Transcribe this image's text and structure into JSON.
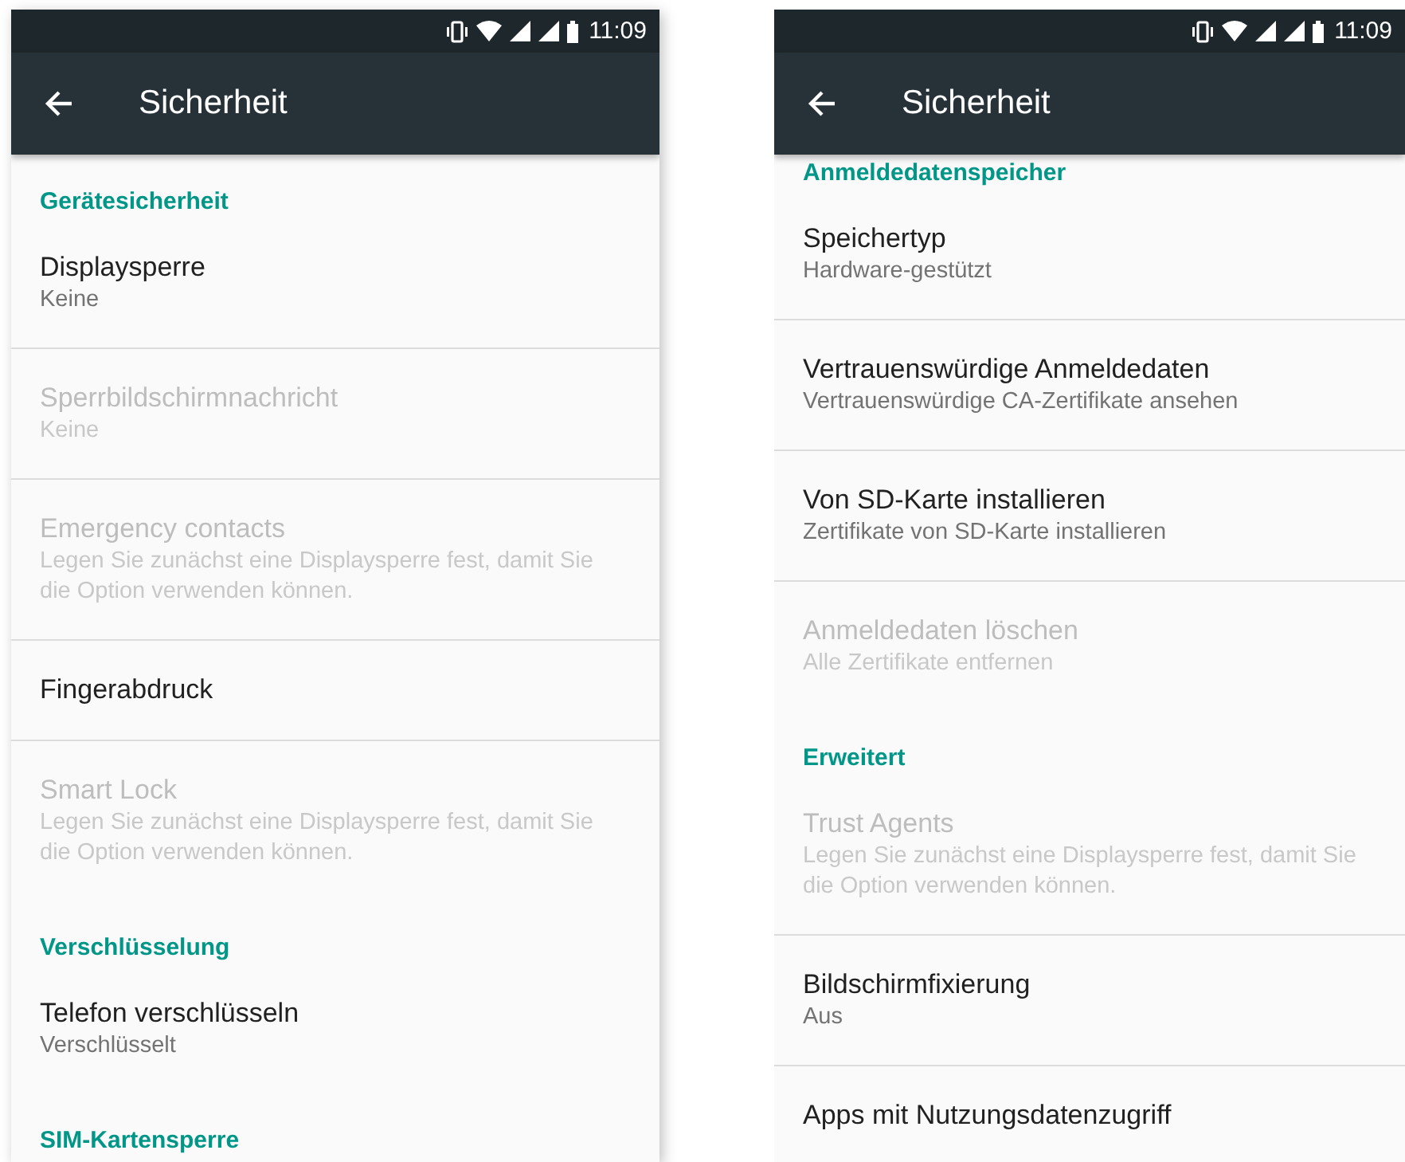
{
  "screens": [
    {
      "status_bar": {
        "time": "11:09"
      },
      "title": "Sicherheit",
      "scrolled": false,
      "items": [
        {
          "kind": "header",
          "title": "Gerätesicherheit"
        },
        {
          "kind": "pref",
          "title": "Displaysperre",
          "summary": "Keine",
          "disabled": false
        },
        {
          "kind": "pref",
          "title": "Sperrbildschirmnachricht",
          "summary": "Keine",
          "disabled": true
        },
        {
          "kind": "pref",
          "title": "Emergency contacts",
          "summary": "Legen Sie zunächst eine Displaysperre fest, damit Sie die Option verwenden können.",
          "disabled": true
        },
        {
          "kind": "pref",
          "title": "Fingerabdruck",
          "disabled": false
        },
        {
          "kind": "pref",
          "title": "Smart Lock",
          "summary": "Legen Sie zunächst eine Displaysperre fest, damit Sie die Option verwenden können.",
          "disabled": true
        },
        {
          "kind": "header",
          "title": "Verschlüsselung"
        },
        {
          "kind": "pref",
          "title": "Telefon verschlüsseln",
          "summary": "Verschlüsselt",
          "disabled": false
        },
        {
          "kind": "header",
          "title": "SIM-Kartensperre"
        }
      ]
    },
    {
      "status_bar": {
        "time": "11:09"
      },
      "title": "Sicherheit",
      "scrolled": true,
      "items": [
        {
          "kind": "header",
          "title": "Anmeldedatenspeicher"
        },
        {
          "kind": "pref",
          "title": "Speichertyp",
          "summary": "Hardware-gestützt",
          "disabled": false
        },
        {
          "kind": "pref",
          "title": "Vertrauenswürdige Anmeldedaten",
          "summary": "Vertrauenswürdige CA-Zertifikate ansehen",
          "disabled": false
        },
        {
          "kind": "pref",
          "title": "Von SD-Karte installieren",
          "summary": "Zertifikate von SD-Karte installieren",
          "disabled": false
        },
        {
          "kind": "pref",
          "title": "Anmeldedaten löschen",
          "summary": "Alle Zertifikate entfernen",
          "disabled": true
        },
        {
          "kind": "header",
          "title": "Erweitert"
        },
        {
          "kind": "pref",
          "title": "Trust Agents",
          "summary": "Legen Sie zunächst eine Displaysperre fest, damit Sie die Option verwenden können.",
          "disabled": true
        },
        {
          "kind": "pref",
          "title": "Bildschirmfixierung",
          "summary": "Aus",
          "disabled": false
        },
        {
          "kind": "pref",
          "title": "Apps mit Nutzungsdatenzugriff",
          "disabled": false
        }
      ]
    }
  ]
}
